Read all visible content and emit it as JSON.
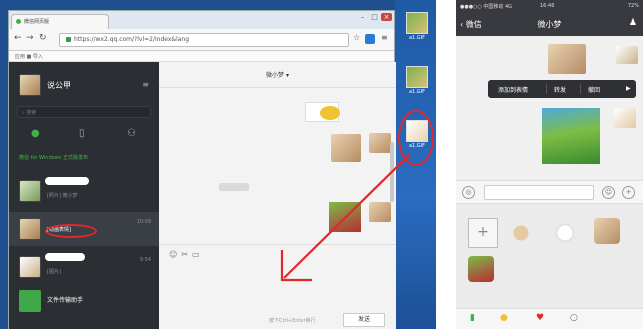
{
  "browser": {
    "tab_title": "微信网页版",
    "url": "https://wx2.qq.com/?lvl=2/index&lang",
    "bookmarks": "应用  ■ 导入"
  },
  "desktop": {
    "icons": [
      {
        "label": "a1.GIF"
      },
      {
        "label": "a1.GIF"
      },
      {
        "label": "a1.GIF"
      }
    ]
  },
  "sidebar": {
    "my_name": "说公甲",
    "search_placeholder": "搜索",
    "notice": "微信 for Windows 正式版发布",
    "chats": [
      {
        "name": "",
        "msg": "[照片] 微小梦",
        "time": ""
      },
      {
        "name": "",
        "msg": "[动画表情]",
        "time": "10:09"
      },
      {
        "name": "",
        "msg": "[图片]",
        "time": "9:54"
      },
      {
        "name": "文件传输助手",
        "msg": "",
        "time": ""
      }
    ]
  },
  "chat": {
    "title": "微小梦",
    "input_hint": "按下Ctrl+Enter换行",
    "send_label": "发送"
  },
  "phone": {
    "status_left": "●●●○○ 中国移动 4G",
    "time": "16:46",
    "battery": "72%",
    "back_label": "微信",
    "title": "微小梦",
    "menu": [
      "添加到表情",
      "转发",
      "撤回"
    ]
  },
  "colors": {
    "wechat_green": "#3fb24a",
    "annotation_red": "#e0282e",
    "sidebar_dark": "#2b2e33"
  }
}
